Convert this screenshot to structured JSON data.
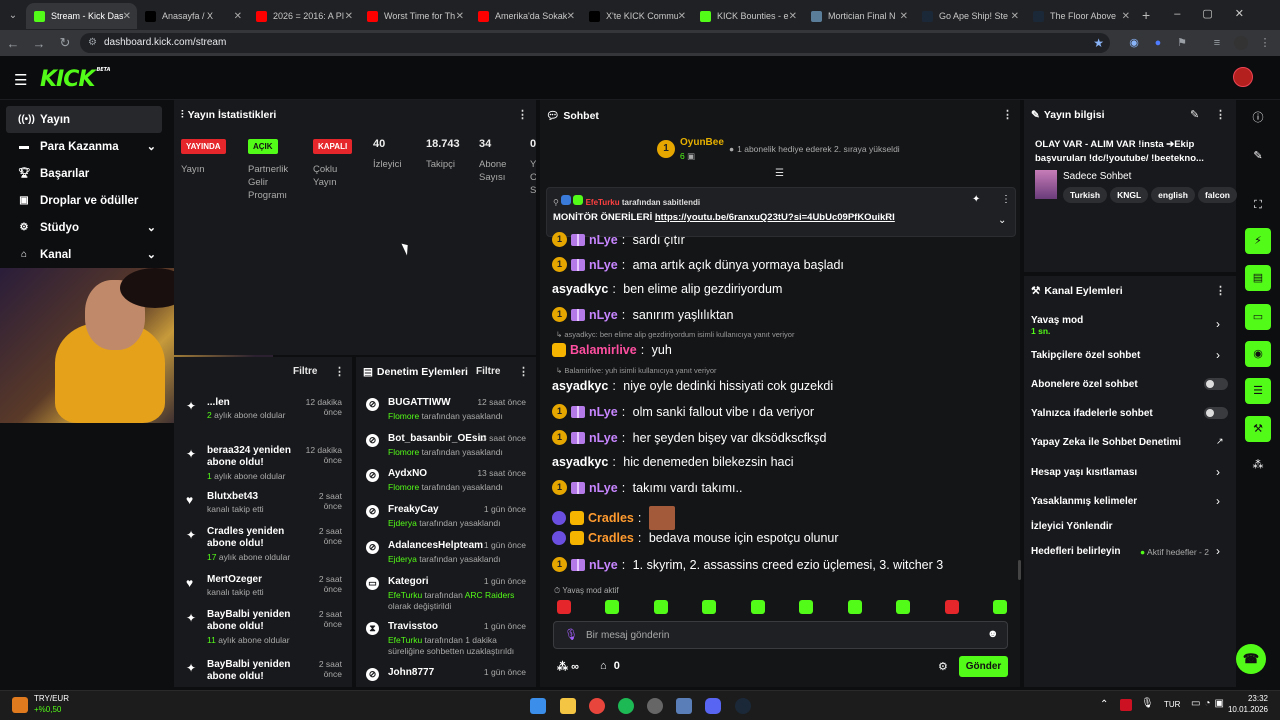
{
  "browser": {
    "tabs": [
      {
        "title": "Stream - Kick Das",
        "color": "#53fc18",
        "active": true
      },
      {
        "title": "Anasayfa / X",
        "color": "#000000"
      },
      {
        "title": "2026 = 2016: A Pl",
        "color": "#ff0000"
      },
      {
        "title": "Worst Time for Th",
        "color": "#ff0000"
      },
      {
        "title": "Amerika'da Sokak",
        "color": "#ff0000"
      },
      {
        "title": "X'te KICK Commu",
        "color": "#000000"
      },
      {
        "title": "KICK Bounties - e",
        "color": "#53fc18"
      },
      {
        "title": "Mortician Final N",
        "color": "#5a7d9a"
      },
      {
        "title": "Go Ape Ship! Ste",
        "color": "#1b2838"
      },
      {
        "title": "The Floor Above",
        "color": "#1b2838"
      }
    ],
    "url": "dashboard.kick.com/stream"
  },
  "brand": {
    "logo": "KICK",
    "beta": "BETA",
    "accent": "#53fc18"
  },
  "sidebar": {
    "items": [
      {
        "label": "Yayın",
        "icon": "broadcast-icon"
      },
      {
        "label": "Para Kazanma",
        "icon": "money-icon"
      },
      {
        "label": "Başarılar",
        "icon": "trophy-icon"
      },
      {
        "label": "Droplar ve ödüller",
        "icon": "gift-icon"
      },
      {
        "label": "Stüdyo",
        "icon": "settings-icon"
      },
      {
        "label": "Kanal",
        "icon": "home-icon"
      }
    ]
  },
  "stats": {
    "title": "Yayın İstatistikleri",
    "live_badge": "YAYINDA",
    "live_label": "Yayın",
    "partner_badge": "AÇIK",
    "partner_label": "Partnerlik Gelir Programı",
    "multi_badge": "KAPALI",
    "multi_label": "Çoklu Yayın",
    "viewers": "40",
    "viewers_label": "İzleyici",
    "followers": "18.743",
    "followers_label": "Takipçi",
    "subs": "34",
    "subs_label": "Abone Sayısı",
    "extra": "0",
    "extra_label": "Y O S"
  },
  "activity": {
    "filter": "Filtre",
    "events": [
      {
        "title": "...len",
        "sub_count": "2",
        "sub": "aylık abone oldular",
        "time": "12 dakika önce"
      },
      {
        "title": "beraa324 yeniden abone oldu!",
        "sub_count": "1",
        "sub": "aylık abone oldular",
        "time": "12 dakika önce"
      },
      {
        "title": "Blutxbet43",
        "sub": "kanalı takip etti",
        "time": "2 saat önce"
      },
      {
        "title": "Cradles yeniden abone oldu!",
        "sub_count": "17",
        "sub": "aylık abone oldular",
        "time": "2 saat önce"
      },
      {
        "title": "MertOzeger",
        "sub": "kanalı takip etti",
        "time": "2 saat önce"
      },
      {
        "title": "BayBalbi yeniden abone oldu!",
        "sub_count": "11",
        "sub": "aylık abone oldular",
        "time": "2 saat önce"
      },
      {
        "title": "BayBalbi yeniden abone oldu!",
        "sub": "",
        "time": "2 saat önce"
      }
    ]
  },
  "modlog": {
    "title": "Denetim Eylemleri",
    "filter": "Filtre",
    "items": [
      {
        "name": "BUGATTIWW",
        "mod": "Flomore",
        "action": "tarafından yasaklandı",
        "time": "12 saat önce"
      },
      {
        "name": "Bot_basanbir_OEsin",
        "mod": "Flomore",
        "action": "tarafından yasaklandı",
        "time": "13 saat önce"
      },
      {
        "name": "AydxNO",
        "mod": "Flomore",
        "action": "tarafından yasaklandı",
        "time": "13 saat önce"
      },
      {
        "name": "FreakyCay",
        "mod": "Ejderya",
        "action": "tarafından yasaklandı",
        "time": "1 gün önce"
      },
      {
        "name": "AdalancesHelpteam",
        "mod": "Ejderya",
        "action": "tarafından yasaklandı",
        "time": "1 gün önce"
      },
      {
        "name": "Kategori",
        "mod": "EfeTurku",
        "action": "tarafından",
        "extra": "ARC Raiders",
        "line2": "olarak değiştirildi",
        "time": "1 gün önce"
      },
      {
        "name": "Travisstoo",
        "mod": "EfeTurku",
        "action": "tarafından 1 dakika",
        "line2": "süreliğine sohbetten uzaklaştırıldı",
        "time": "1 gün önce"
      },
      {
        "name": "John8777",
        "time": "1 gün önce"
      }
    ]
  },
  "chat": {
    "title": "Sohbet",
    "gifter_name": "OyunBee",
    "gifter_count": "6",
    "gift_text": "1 abonelik hediye ederek 2. sıraya yükseldi",
    "pinned_by": "EfeTurku",
    "pinned_label": "tarafından sabitlendi",
    "pinned_text": "MONİTÖR ÖNERİLERİ",
    "pinned_link": "https://youtu.be/6ranxuQ23tU?si=4UbUc09PfKOuikRI",
    "messages": [
      {
        "user": "nLye",
        "color": "#c786ff",
        "text": "sardı çıtır"
      },
      {
        "user": "nLye",
        "color": "#c786ff",
        "text": "ama artık açık dünya yormaya başladı"
      },
      {
        "user": "asyadkyc",
        "color": "#ffffff",
        "text": "ben elime alip gezdiriyordum"
      },
      {
        "user": "nLye",
        "color": "#c786ff",
        "text": "sanırım yaşlılıktan"
      },
      {
        "user": "Balamirlive",
        "color": "#ff4fa0",
        "text": "yuh",
        "reply": "asyadkyc: ben elime alip gezdiriyordum isimli kullanıcıya yanıt veriyor"
      },
      {
        "user": "asyadkyc",
        "color": "#ffffff",
        "text": "niye oyle dedinki hissiyati cok guzekdi",
        "reply": "Balamirlive: yuh isimli kullanıcıya yanıt veriyor"
      },
      {
        "user": "nLye",
        "color": "#c786ff",
        "text": "olm sanki fallout vibe ı da veriyor"
      },
      {
        "user": "nLye",
        "color": "#c786ff",
        "text": "her şeyden bişey var dksödkscfkşd"
      },
      {
        "user": "asyadkyc",
        "color": "#ffffff",
        "text": "hic denemeden bilekezsin haci"
      },
      {
        "user": "nLye",
        "color": "#c786ff",
        "text": "takımı vardı takımı.."
      },
      {
        "user": "Cradles",
        "color": "#ff9b2f",
        "text": ""
      },
      {
        "user": "Cradles",
        "color": "#ff9b2f",
        "text": "bedava mouse için espotçu olunur"
      },
      {
        "user": "nLye",
        "color": "#c786ff",
        "text": "1. skyrim, 2. assassins creed ezio üçlemesi, 3. witcher 3"
      }
    ],
    "slow_mode": "Yavaş mod aktif",
    "input_placeholder": "Bir mesaj gönderin",
    "points_label": "∞",
    "store_count": "0",
    "send_label": "Gönder"
  },
  "stream_info": {
    "title": "Yayın bilgisi",
    "stream_title": "OLAY VAR - ALIM VAR !insta ➔Ekip başvuruları !dc/!youtube/ !beeteknо...",
    "category": "Sadece Sohbet",
    "tags": [
      "Turkish",
      "KNGL",
      "english",
      "falcon"
    ]
  },
  "channel_actions": {
    "title": "Kanal Eylemleri",
    "slow_mode": "Yavaş mod",
    "slow_mode_value": "1 sn.",
    "followers_only": "Takipçilere özel sohbet",
    "subs_only": "Abonelere özel sohbet",
    "emote_only": "Yalnızca ifadelerle sohbet",
    "ai_mod": "Yapay Zeka ile Sohbet Denetimi",
    "age_restrict": "Hesap yaşı kısıtlaması",
    "banned_words": "Yasaklanmış kelimeler",
    "host": "İzleyici Yönlendir",
    "goals": "Hedefleri belirleyin",
    "goals_status": "Aktif hedefler - 2"
  },
  "taskbar": {
    "ticker": "TRY/EUR",
    "ticker_change": "+%0,50",
    "lang": "TUR",
    "time": "23:32",
    "date": "10.01.2026"
  }
}
